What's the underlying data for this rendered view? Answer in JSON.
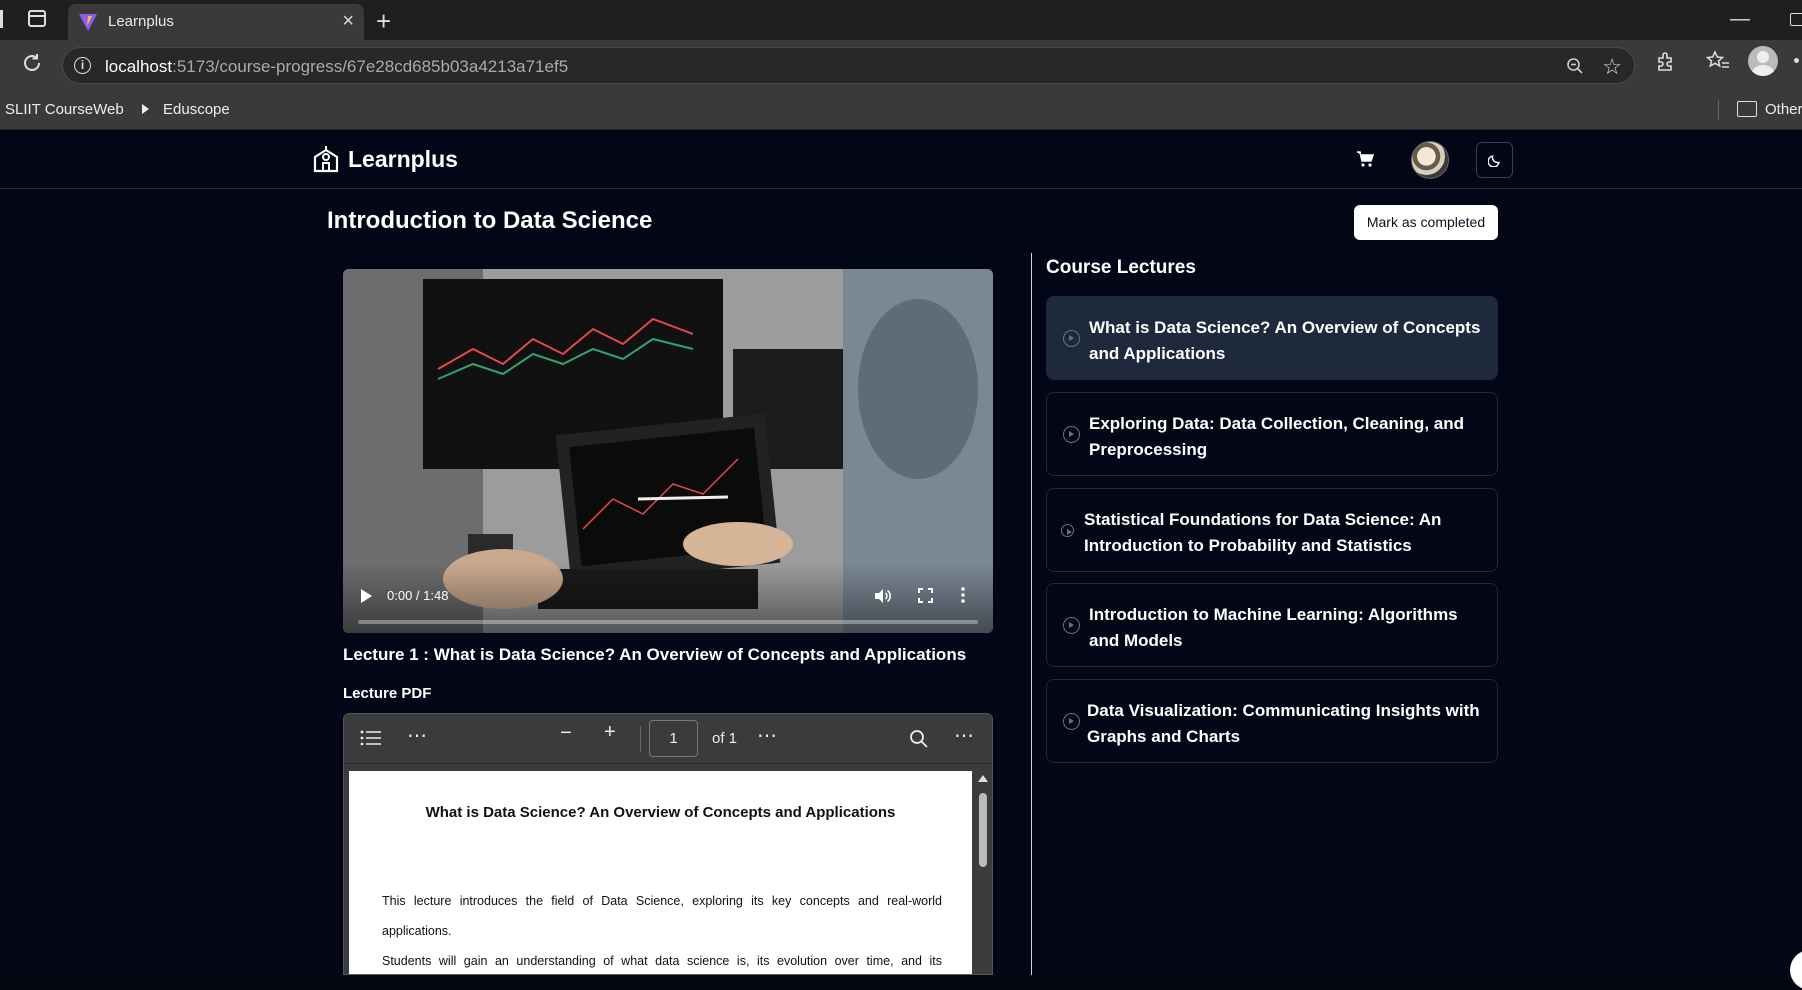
{
  "browser": {
    "tab_title": "Learnplus",
    "url_host": "localhost",
    "url_path": ":5173/course-progress/67e28cd685b03a4213a71ef5",
    "bookmarks": [
      "SLIIT CourseWeb",
      "Eduscope"
    ],
    "other_bookmarks": "Other"
  },
  "app": {
    "brand": "Learnplus",
    "course_title": "Introduction to Data Science",
    "mark_completed_label": "Mark as completed"
  },
  "video": {
    "time": "0:00 / 1:48",
    "progress": 0
  },
  "lecture": {
    "heading": "Lecture 1 : What is Data Science? An Overview of Concepts and Applications",
    "pdf_label": "Lecture PDF"
  },
  "pdf": {
    "page_number": "1",
    "page_total": "of 1",
    "doc_title": "What is Data Science? An Overview of Concepts and Applications",
    "para1_line1": "This lecture introduces the field of Data Science, exploring its key concepts and real-world",
    "para1_line2": "applications.",
    "para2_line1": "Students will gain an understanding of what data science is, its evolution over time, and its"
  },
  "sidebar": {
    "title": "Course Lectures",
    "lectures": [
      {
        "title": "What is Data Science? An Overview of Concepts and Applications"
      },
      {
        "title": "Exploring Data: Data Collection, Cleaning, and Preprocessing"
      },
      {
        "title": "Statistical Foundations for Data Science: An Introduction to Probability and Statistics"
      },
      {
        "title": "Introduction to Machine Learning: Algorithms and Models"
      },
      {
        "title": "Data Visualization: Communicating Insights with Graphs and Charts"
      }
    ],
    "active_index": 0
  },
  "colors": {
    "background": "#020617",
    "active_card": "#1e293b",
    "card_border": "#1f2937"
  }
}
